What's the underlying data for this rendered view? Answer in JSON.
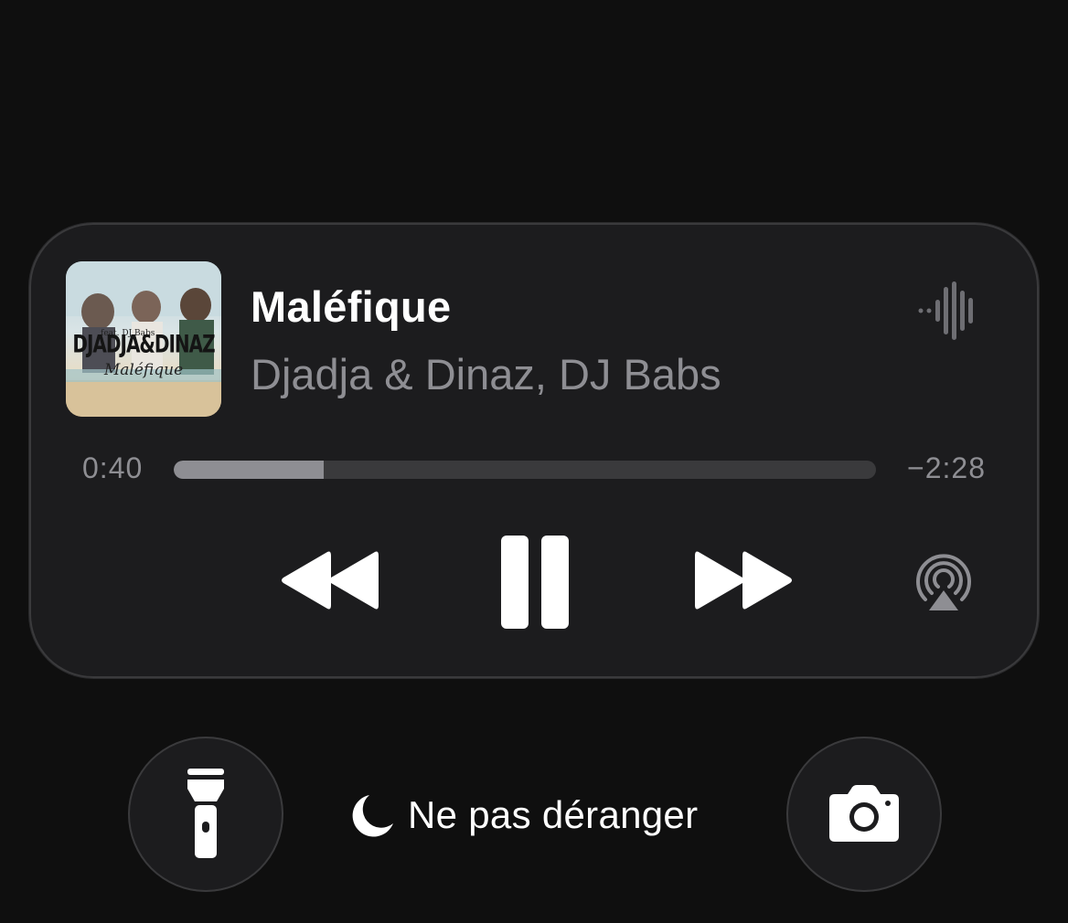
{
  "now_playing": {
    "title": "Maléfique",
    "artist": "Djadja & Dinaz, DJ Babs",
    "artwork": {
      "feat_text": "feat. DJ Babs",
      "title_text": "DJADJA&DINAZ",
      "subtitle_text": "Maléfique"
    },
    "elapsed": "0:40",
    "remaining": "−2:28",
    "progress_fraction": 0.214,
    "icons": {
      "waveform": "waveform-icon",
      "rewind": "rewind-icon",
      "pause": "pause-icon",
      "forward": "forward-icon",
      "airplay": "airplay-icon"
    }
  },
  "bottom_bar": {
    "flashlight_icon": "flashlight-icon",
    "camera_icon": "camera-icon",
    "dnd_icon": "moon-icon",
    "dnd_label": "Ne pas déranger"
  },
  "colors": {
    "background": "#0f0f0f",
    "card": "#1c1c1e",
    "primary_text": "#ffffff",
    "secondary_text": "#8e8e93",
    "track": "#3a3a3c"
  }
}
